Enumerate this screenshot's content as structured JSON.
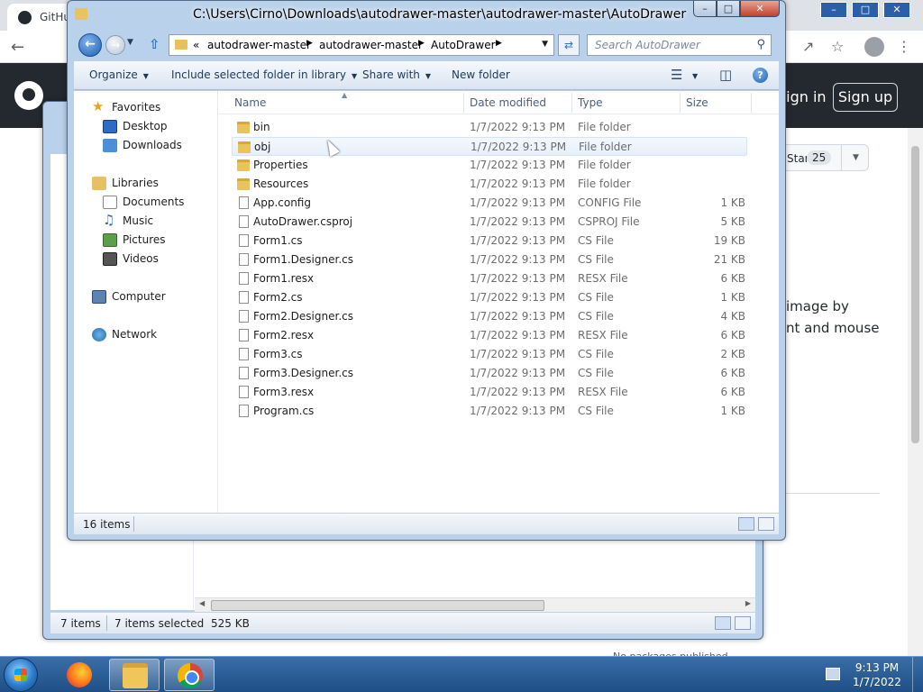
{
  "browser": {
    "tab_title": "GitHub",
    "signin_label": "Sign in",
    "signup_label": "Sign up",
    "star_label": "Star",
    "star_count": "25",
    "about_text_1": "image by",
    "about_text_2": "nt and mouse",
    "packages_text": "No packages published"
  },
  "front_window": {
    "title": "C:\\Users\\Cirno\\Downloads\\autodrawer-master\\autodrawer-master\\AutoDrawer",
    "address": {
      "overflow": "«",
      "segments": [
        "autodrawer-master",
        "autodrawer-master",
        "AutoDrawer"
      ]
    },
    "search_placeholder": "Search AutoDrawer",
    "toolbar": {
      "organize": "Organize",
      "include_library": "Include selected folder in library",
      "share_with": "Share with",
      "new_folder": "New folder"
    },
    "nav_pane": {
      "favorites": "Favorites",
      "desktop": "Desktop",
      "downloads": "Downloads",
      "libraries": "Libraries",
      "documents": "Documents",
      "music": "Music",
      "pictures": "Pictures",
      "videos": "Videos",
      "computer": "Computer",
      "network": "Network"
    },
    "columns": {
      "name": "Name",
      "date": "Date modified",
      "type": "Type",
      "size": "Size"
    },
    "files": [
      {
        "name": "bin",
        "date": "1/7/2022 9:13 PM",
        "type": "File folder",
        "size": "",
        "kind": "folder"
      },
      {
        "name": "obj",
        "date": "1/7/2022 9:13 PM",
        "type": "File folder",
        "size": "",
        "kind": "folder"
      },
      {
        "name": "Properties",
        "date": "1/7/2022 9:13 PM",
        "type": "File folder",
        "size": "",
        "kind": "folder"
      },
      {
        "name": "Resources",
        "date": "1/7/2022 9:13 PM",
        "type": "File folder",
        "size": "",
        "kind": "folder"
      },
      {
        "name": "App.config",
        "date": "1/7/2022 9:13 PM",
        "type": "CONFIG File",
        "size": "1 KB",
        "kind": "file"
      },
      {
        "name": "AutoDrawer.csproj",
        "date": "1/7/2022 9:13 PM",
        "type": "CSPROJ File",
        "size": "5 KB",
        "kind": "file"
      },
      {
        "name": "Form1.cs",
        "date": "1/7/2022 9:13 PM",
        "type": "CS File",
        "size": "19 KB",
        "kind": "file"
      },
      {
        "name": "Form1.Designer.cs",
        "date": "1/7/2022 9:13 PM",
        "type": "CS File",
        "size": "21 KB",
        "kind": "file"
      },
      {
        "name": "Form1.resx",
        "date": "1/7/2022 9:13 PM",
        "type": "RESX File",
        "size": "6 KB",
        "kind": "file"
      },
      {
        "name": "Form2.cs",
        "date": "1/7/2022 9:13 PM",
        "type": "CS File",
        "size": "1 KB",
        "kind": "file"
      },
      {
        "name": "Form2.Designer.cs",
        "date": "1/7/2022 9:13 PM",
        "type": "CS File",
        "size": "4 KB",
        "kind": "file"
      },
      {
        "name": "Form2.resx",
        "date": "1/7/2022 9:13 PM",
        "type": "RESX File",
        "size": "6 KB",
        "kind": "file"
      },
      {
        "name": "Form3.cs",
        "date": "1/7/2022 9:13 PM",
        "type": "CS File",
        "size": "2 KB",
        "kind": "file"
      },
      {
        "name": "Form3.Designer.cs",
        "date": "1/7/2022 9:13 PM",
        "type": "CS File",
        "size": "6 KB",
        "kind": "file"
      },
      {
        "name": "Form3.resx",
        "date": "1/7/2022 9:13 PM",
        "type": "RESX File",
        "size": "6 KB",
        "kind": "file"
      },
      {
        "name": "Program.cs",
        "date": "1/7/2022 9:13 PM",
        "type": "CS File",
        "size": "1 KB",
        "kind": "file"
      }
    ],
    "hovered_row": "obj",
    "status": {
      "items": "16 items"
    }
  },
  "back_window": {
    "status": {
      "items": "7 items",
      "selected": "7 items selected",
      "size": "525 KB"
    }
  },
  "taskbar": {
    "time": "9:13 PM",
    "date": "1/7/2022"
  },
  "colors": {
    "win_frame": "#b9d1ea",
    "taskbar": "#2a5c94",
    "github_header": "#24292f"
  }
}
